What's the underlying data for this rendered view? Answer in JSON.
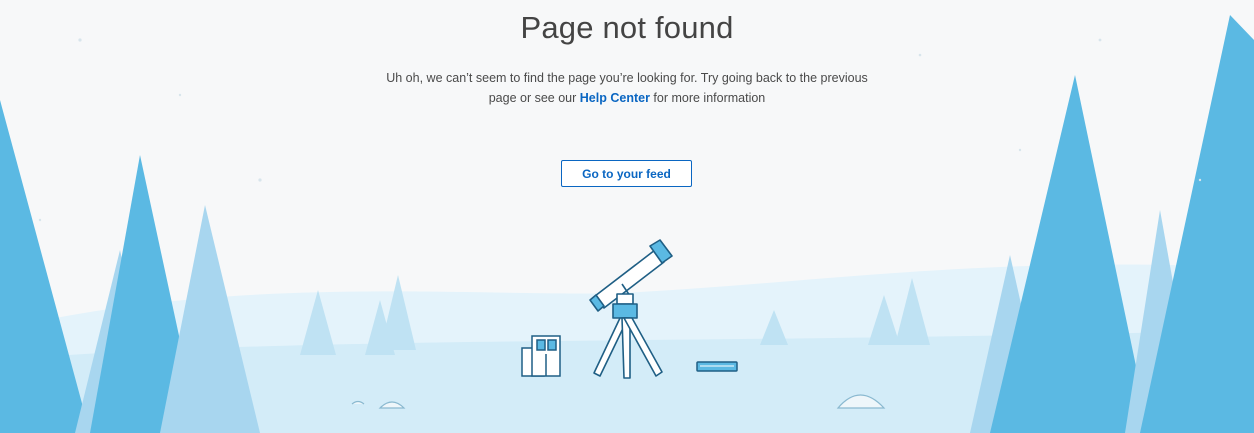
{
  "error": {
    "title": "Page not found",
    "message_before": "Uh oh, we can’t seem to find the page you’re looking for. Try going back to the previous page or see our ",
    "help_link": "Help Center",
    "message_after": " for more information"
  },
  "actions": {
    "go_to_feed": "Go to your feed"
  },
  "colors": {
    "accent": "#0a66c2",
    "tree_dark": "#5bb9e3",
    "tree_light": "#a8d6ef",
    "ground": "#e2f3fb",
    "background": "#f7f8f9"
  },
  "illustration": {
    "icons": [
      "telescope-icon",
      "book-icon",
      "tablet-icon",
      "rock-icon"
    ]
  }
}
